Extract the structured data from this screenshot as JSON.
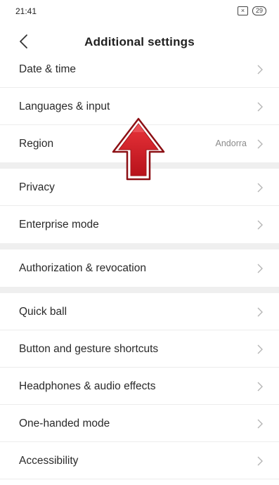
{
  "status_bar": {
    "time": "21:41",
    "sim_glyph": "×",
    "battery": "29"
  },
  "header": {
    "title": "Additional settings"
  },
  "sections": [
    {
      "items": [
        {
          "label": "Date & time",
          "value": ""
        },
        {
          "label": "Languages & input",
          "value": ""
        },
        {
          "label": "Region",
          "value": "Andorra"
        }
      ]
    },
    {
      "items": [
        {
          "label": "Privacy",
          "value": ""
        },
        {
          "label": "Enterprise mode",
          "value": ""
        }
      ]
    },
    {
      "items": [
        {
          "label": "Authorization & revocation",
          "value": ""
        }
      ]
    },
    {
      "items": [
        {
          "label": "Quick ball",
          "value": ""
        },
        {
          "label": "Button and gesture shortcuts",
          "value": ""
        },
        {
          "label": "Headphones & audio effects",
          "value": ""
        },
        {
          "label": "One-handed mode",
          "value": ""
        },
        {
          "label": "Accessibility",
          "value": ""
        }
      ]
    }
  ],
  "colors": {
    "accent_arrow": "#d91e26",
    "divider": "#ececec",
    "section_gap": "#efefef",
    "chevron": "#b5b5b5"
  },
  "icons": {
    "back": "chevron-left-icon",
    "row": "chevron-right-icon",
    "overlay": "up-arrow-icon"
  }
}
